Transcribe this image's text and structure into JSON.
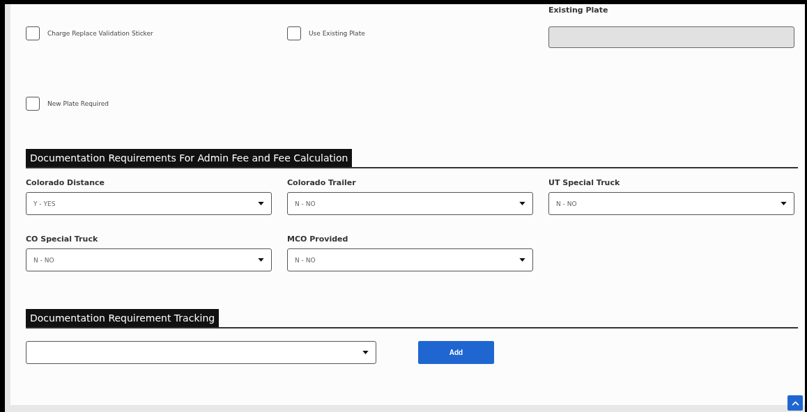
{
  "options": [
    {
      "label": "Charge Replace Validation Sticker",
      "checked": false
    },
    {
      "label": "Use Existing Plate",
      "checked": false
    },
    {
      "label": "New Plate Required",
      "checked": false
    }
  ],
  "existing_plate": {
    "label": "Existing Plate",
    "disabled": true
  },
  "fee_section": {
    "title": "Documentation Requirements For Admin Fee and Fee Calculation",
    "fields": [
      {
        "label": "Colorado Distance",
        "value": "Y - YES"
      },
      {
        "label": "Colorado Trailer",
        "value": "N - NO"
      },
      {
        "label": "UT Special Truck",
        "value": "N - NO"
      },
      {
        "label": "CO Special Truck",
        "value": "N - NO"
      },
      {
        "label": "MCO Provided",
        "value": "N - NO"
      }
    ]
  },
  "tracking_section": {
    "title": "Documentation Requirement Tracking",
    "add_button": "Add"
  }
}
